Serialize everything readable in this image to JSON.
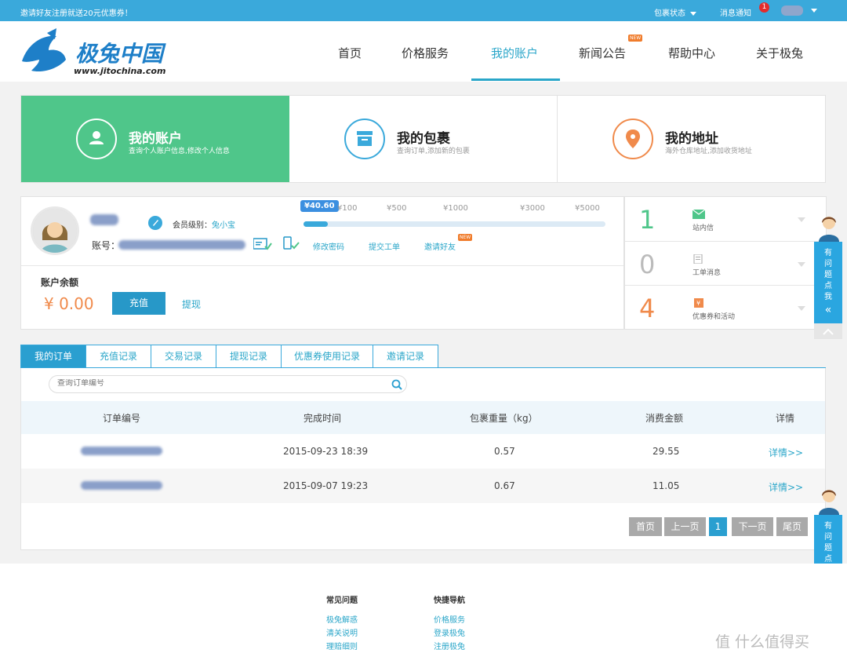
{
  "topbar": {
    "promo": "邀请好友注册就送20元优惠券！",
    "package_status": "包裹状态",
    "notifications": "消息通知",
    "notification_count": "1"
  },
  "brand": {
    "name": "极兔中国",
    "url": "www.jitochina.com"
  },
  "nav": {
    "items": [
      {
        "label": "首页"
      },
      {
        "label": "价格服务"
      },
      {
        "label": "我的账户"
      },
      {
        "label": "新闻公告",
        "tag": "NEW"
      },
      {
        "label": "帮助中心"
      },
      {
        "label": "关于极兔"
      }
    ],
    "active": "我的账户"
  },
  "cards": [
    {
      "title": "我的账户",
      "subtitle": "查询个人账户信息,修改个人信息",
      "icon": "user-icon"
    },
    {
      "title": "我的包裹",
      "subtitle": "查询订单,添加新的包裹",
      "icon": "package-icon"
    },
    {
      "title": "我的地址",
      "subtitle": "海外仓库地址,添加收货地址",
      "icon": "location-pin-icon"
    }
  ],
  "account": {
    "member_level_label": "会员级别：",
    "member_level": "兔小宝",
    "account_label": "账号：",
    "links": [
      "修改密码",
      "提交工单",
      "邀请好友"
    ],
    "invite_tag": "NEW",
    "progress": {
      "current": "¥40.60",
      "current_value": 40.6,
      "max_value": 5000,
      "ticks": [
        "¥100",
        "¥500",
        "¥1000",
        "¥3000",
        "¥5000"
      ]
    },
    "balance_label": "账户余额",
    "balance": "¥ 0.00",
    "recharge": "充值",
    "withdraw": "提现"
  },
  "messages": [
    {
      "count": "1",
      "label": "站内信",
      "color": "#4fc68a"
    },
    {
      "count": "0",
      "label": "工单消息",
      "color": "#bbbbbb"
    },
    {
      "count": "4",
      "label": "优惠券和活动",
      "color": "#f08a4b"
    }
  ],
  "side_help": {
    "text": "有问题点我"
  },
  "tabs": [
    "我的订单",
    "充值记录",
    "交易记录",
    "提现记录",
    "优惠券使用记录",
    "邀请记录"
  ],
  "search": {
    "placeholder": "查询订单编号"
  },
  "table": {
    "headers": [
      "订单编号",
      "完成时间",
      "包裹重量（kg）",
      "消费金额",
      "详情"
    ],
    "rows": [
      {
        "time": "2015-09-23 18:39",
        "weight": "0.57",
        "amount": "29.55",
        "detail": "详情>>"
      },
      {
        "time": "2015-09-07 19:23",
        "weight": "0.67",
        "amount": "11.05",
        "detail": "详情>>"
      }
    ]
  },
  "pager": {
    "first": "首页",
    "prev": "上一页",
    "current": "1",
    "next": "下一页",
    "last": "尾页"
  },
  "footer": {
    "col1": {
      "title": "常见问题",
      "links": [
        "极兔解惑",
        "清关说明",
        "理赔细则"
      ]
    },
    "col2": {
      "title": "快捷导航",
      "links": [
        "价格服务",
        "登录极兔",
        "注册极兔"
      ]
    }
  },
  "watermark": "值 什么值得买"
}
